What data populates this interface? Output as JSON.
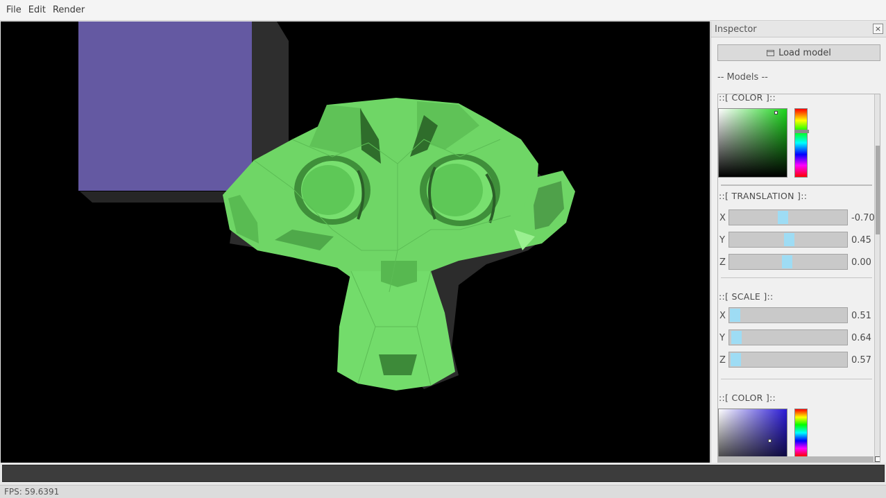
{
  "menu": {
    "items": [
      "File",
      "Edit",
      "Render"
    ]
  },
  "inspector": {
    "title": "Inspector",
    "close_icon": "×",
    "load_button": "Load model",
    "models_heading": "-- Models --",
    "models": [
      {
        "color_title": "::[ COLOR ]::",
        "color_hex": "#4ea84a",
        "translation_title": "::[ TRANSLATION ]::",
        "translation": [
          {
            "axis": "X",
            "value": "-0.70"
          },
          {
            "axis": "Y",
            "value": "0.45"
          },
          {
            "axis": "Z",
            "value": "0.00"
          }
        ],
        "scale_title": "::[ SCALE ]::",
        "scale": [
          {
            "axis": "X",
            "value": "0.51"
          },
          {
            "axis": "Y",
            "value": "0.64"
          },
          {
            "axis": "Z",
            "value": "0.57"
          }
        ]
      },
      {
        "color_title": "::[ COLOR ]::",
        "color_hex": "#5b4fa8"
      }
    ]
  },
  "status": {
    "fps": "FPS: 59.6391"
  },
  "colors": {
    "accent_thumb": "#9edcf4",
    "monkey_green": "#6fd666",
    "cube_purple": "#6459a2"
  },
  "icons": [
    "close-icon",
    "folder-icon"
  ]
}
